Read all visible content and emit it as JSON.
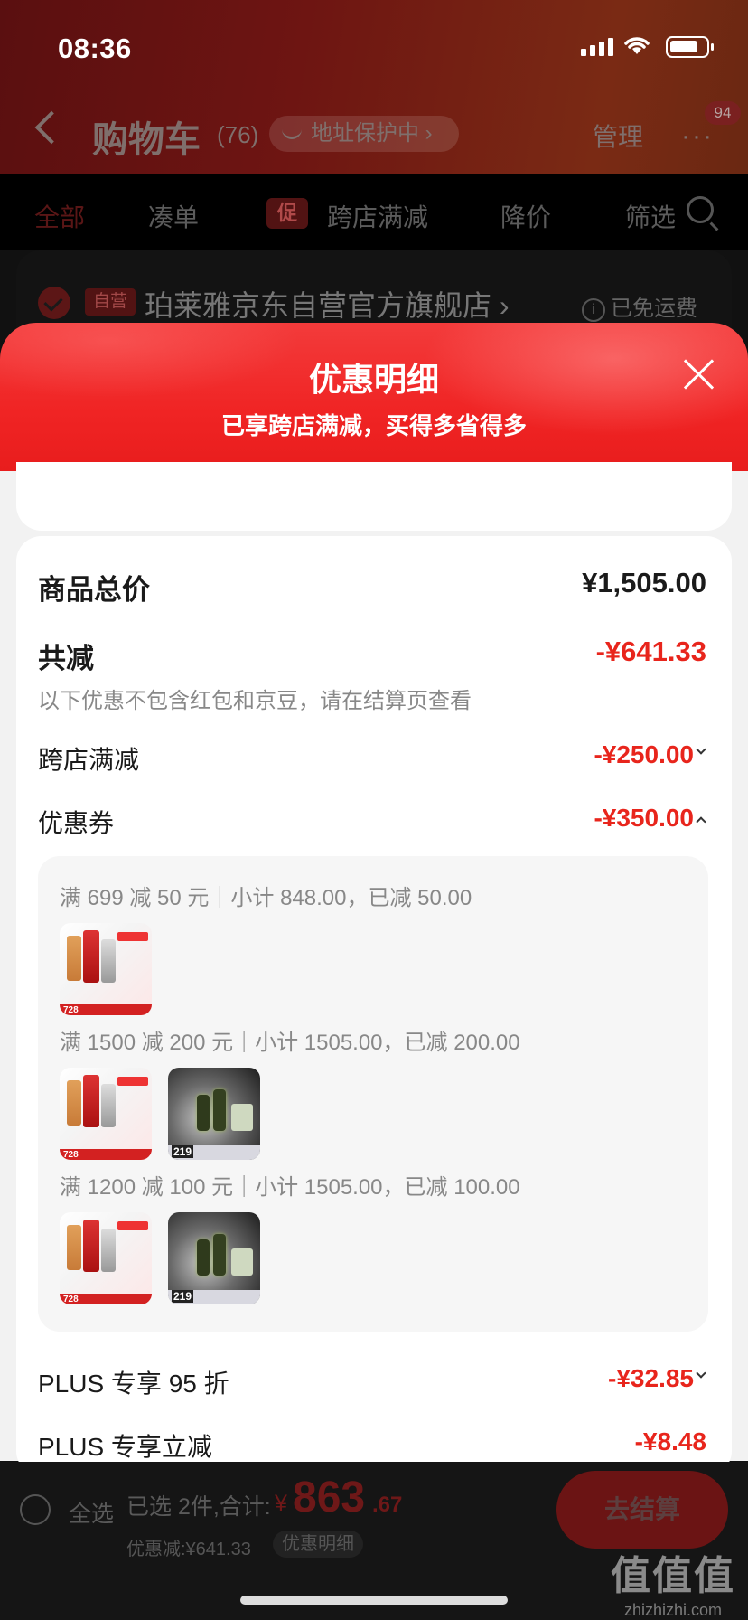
{
  "status": {
    "time": "08:36"
  },
  "header": {
    "title": "购物车",
    "count": "(76)",
    "address_protect": "地址保护中 ›",
    "manage": "管理",
    "more": "···",
    "badge": "94"
  },
  "tabs": {
    "all": "全部",
    "bundle": "凑单",
    "promo_badge": "促",
    "cross_store": "跨店满减",
    "price_drop": "降价",
    "filter": "筛选"
  },
  "shop": {
    "self_badge": "自营",
    "name": "珀莱雅京东自营官方旗舰店 ›",
    "free_shipping": "已免运费",
    "info_icon": "i"
  },
  "sheet": {
    "title": "优惠明细",
    "subtitle": "已享跨店满减，买得多省得多"
  },
  "summary": {
    "total_label": "商品总价",
    "total_value": "¥1,505.00",
    "reduce_label": "共减",
    "reduce_value": "-¥641.33",
    "note": "以下优惠不包含红包和京豆，请在结算页查看",
    "cross_label": "跨店满减",
    "cross_value": "-¥250.00",
    "coupon_label": "优惠券",
    "coupon_value": "-¥350.00",
    "plus95_label": "PLUS 专享 95 折",
    "plus95_value": "-¥32.85",
    "plus_off_label": "PLUS 专享立减",
    "plus_off_value": "-¥8.48"
  },
  "coupons": [
    {
      "text": "满 699 减 50 元｜小计 848.00，已减 50.00"
    },
    {
      "text": "满 1500 减 200 元｜小计 1505.00，已减 200.00"
    },
    {
      "text": "满 1200 减 100 元｜小计 1505.00，已减 100.00"
    }
  ],
  "thumbs": {
    "a_price": "728",
    "b_price": "219"
  },
  "bottom": {
    "select_all": "全选",
    "selected": "已选 2件,合计:",
    "currency": "¥",
    "total_int": "863",
    "total_dec": ".67",
    "discount": "优惠减:¥641.33",
    "detail_pill": "优惠明细",
    "checkout": "去结算"
  },
  "watermark": {
    "logo": "值值值",
    "url": "zhizhizhi.com"
  },
  "icons": [
    "back-icon",
    "eye-icon",
    "more-icon",
    "search-icon",
    "check-icon",
    "info-icon",
    "close-icon",
    "chevron-down-icon",
    "chevron-up-icon",
    "signal-icon",
    "wifi-icon",
    "battery-icon"
  ]
}
